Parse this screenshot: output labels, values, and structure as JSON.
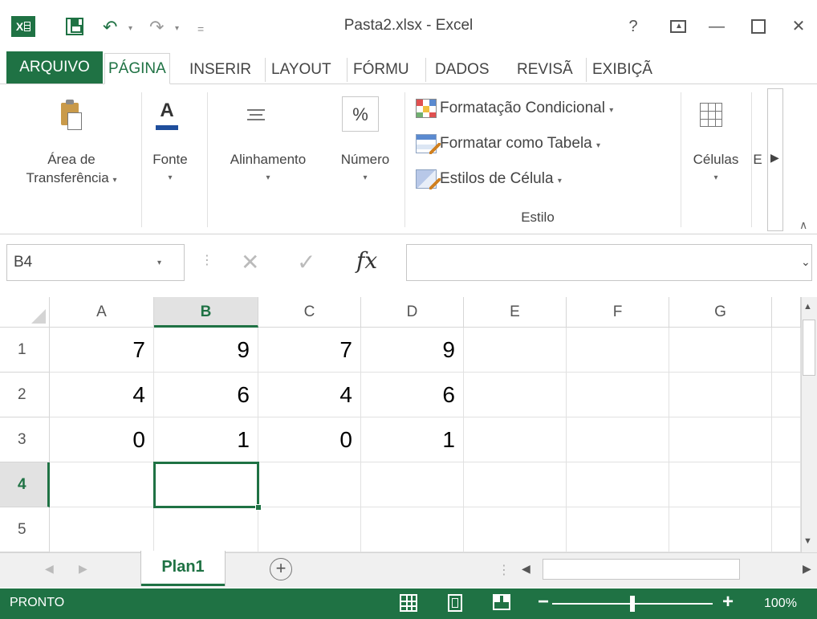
{
  "window": {
    "title": "Pasta2.xlsx - Excel",
    "help": "?",
    "minimize": "—",
    "close": "✕"
  },
  "tabs": [
    "ARQUIVO",
    "PÁGINA",
    "INSERIR",
    "LAYOUT",
    "FÓRMU",
    "DADOS",
    "REVISÃ",
    "EXIBIÇÃ"
  ],
  "ribbon": {
    "clipboard": {
      "line1": "Área de",
      "line2": "Transferência"
    },
    "font": {
      "label": "Fonte",
      "glyph": "A"
    },
    "alignment": {
      "label": "Alinhamento"
    },
    "number": {
      "label": "Número",
      "glyph": "%"
    },
    "style": {
      "conditional": "Formatação Condicional",
      "as_table": "Formatar como Tabela",
      "cell_styles": "Estilos de Célula",
      "group_label": "Estilo"
    },
    "cells": {
      "label": "Células"
    },
    "editing_truncated": "E"
  },
  "formula_bar": {
    "name_box": "B4",
    "fx": "fx",
    "cancel": "✕",
    "enter": "✓",
    "formula_value": ""
  },
  "sheet": {
    "columns": [
      "A",
      "B",
      "C",
      "D",
      "E",
      "F",
      "G"
    ],
    "rows": [
      "1",
      "2",
      "3",
      "4",
      "5"
    ],
    "cells": [
      [
        "7",
        "9",
        "7",
        "9",
        "",
        "",
        ""
      ],
      [
        "4",
        "6",
        "4",
        "6",
        "",
        "",
        ""
      ],
      [
        "0",
        "1",
        "0",
        "1",
        "",
        "",
        ""
      ],
      [
        "",
        "",
        "",
        "",
        "",
        "",
        ""
      ],
      [
        "",
        "",
        "",
        "",
        "",
        "",
        ""
      ]
    ],
    "selected_col": "B",
    "selected_row": "4"
  },
  "sheet_tabs": {
    "active": "Plan1",
    "add": "+"
  },
  "status": {
    "ready": "PRONTO",
    "zoom_minus": "−",
    "zoom_plus": "+",
    "zoom": "100%",
    "zoom_level": 1.0
  },
  "colors": {
    "excel_green": "#1f7244",
    "status_bg": "#1f7244"
  }
}
